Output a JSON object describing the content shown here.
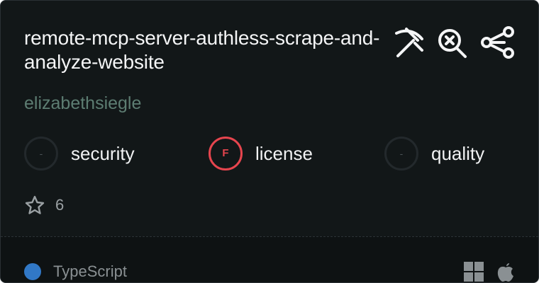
{
  "server": {
    "title_line1": "remote-mcp-server-authless-scrape-and-",
    "title_line2": "analyze-website",
    "author": "elizabethsiegle"
  },
  "top_icons": [
    "pickaxe-icon",
    "search-icon",
    "share-icon"
  ],
  "metrics": [
    {
      "label": "security",
      "grade": "-",
      "status": "none"
    },
    {
      "label": "license",
      "grade": "F",
      "status": "fail"
    },
    {
      "label": "quality",
      "grade": "-",
      "status": "none"
    }
  ],
  "stars": {
    "count": "6",
    "icon": "star-icon"
  },
  "language": {
    "name": "TypeScript",
    "color": "#3178c6"
  },
  "platforms": [
    "windows-icon",
    "apple-icon"
  ],
  "colors": {
    "background": "#121718",
    "author": "#5d7d72",
    "fail": "#e6454e",
    "muted": "#8a9093"
  }
}
